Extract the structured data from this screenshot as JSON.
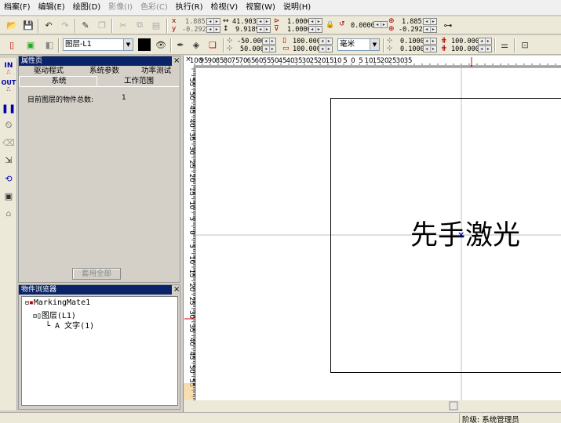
{
  "menu": [
    {
      "label": "档案(F)",
      "enabled": true
    },
    {
      "label": "编辑(E)",
      "enabled": true
    },
    {
      "label": "绘图(D)",
      "enabled": true
    },
    {
      "label": "影像(I)",
      "enabled": false
    },
    {
      "label": "色彩(C)",
      "enabled": false
    },
    {
      "label": "执行(R)",
      "enabled": true
    },
    {
      "label": "检视(V)",
      "enabled": true
    },
    {
      "label": "视窗(W)",
      "enabled": true
    },
    {
      "label": "说明(H)",
      "enabled": true
    }
  ],
  "toolbar1": {
    "pos_x": "1.8851",
    "pos_y": "-0.2922",
    "width": "41.9031",
    "height": "9.9189",
    "scale_x": "1.0000",
    "scale_y": "1.0000",
    "angle": "0.0000",
    "rot_x": "1.8851",
    "rot_y": "-0.2922"
  },
  "toolbar2": {
    "layer": "图层-L1",
    "offset_x": "-50.0000",
    "offset_y": "50.0000",
    "size_w": "100.0000",
    "size_h": "100.0000",
    "unit": "毫米",
    "step_x": "0.1000",
    "step_y": "0.1000",
    "grid_x": "100.0000",
    "grid_y": "100.0000"
  },
  "left_tools": [
    {
      "icon": "in-icon",
      "label": "IN"
    },
    {
      "icon": "out-icon",
      "label": "OUT"
    }
  ],
  "property_panel": {
    "title": "属性页",
    "tabs": [
      "驱动程式",
      "系统参数",
      "功率测试",
      "系统",
      "工作范围"
    ],
    "object_count_label": "目前图层的物件总数:",
    "object_count_value": "1",
    "apply_all_button": "套用全部"
  },
  "browser_panel": {
    "title": "物件浏览器",
    "root": "MarkingMate1",
    "layer": "图层(L1)",
    "item": "文字(1)"
  },
  "canvas": {
    "text": "先手激光"
  },
  "ruler": {
    "h_labels": [
      "100",
      "95",
      "90",
      "85",
      "80",
      "75",
      "70",
      "65",
      "60",
      "55",
      "50",
      "45",
      "40",
      "35",
      "30",
      "25",
      "20",
      "15",
      "10",
      "5",
      "0",
      "5",
      "10",
      "15",
      "20",
      "25",
      "30",
      "35"
    ],
    "v_labels": [
      "55",
      "50",
      "45",
      "40",
      "35",
      "30",
      "25",
      "20",
      "15",
      "10",
      "5",
      "0",
      "5",
      "10",
      "15",
      "20",
      "25",
      "30",
      "35",
      "40",
      "45",
      "50",
      "55"
    ]
  },
  "status": {
    "level": "阶级: 系统管理员"
  }
}
